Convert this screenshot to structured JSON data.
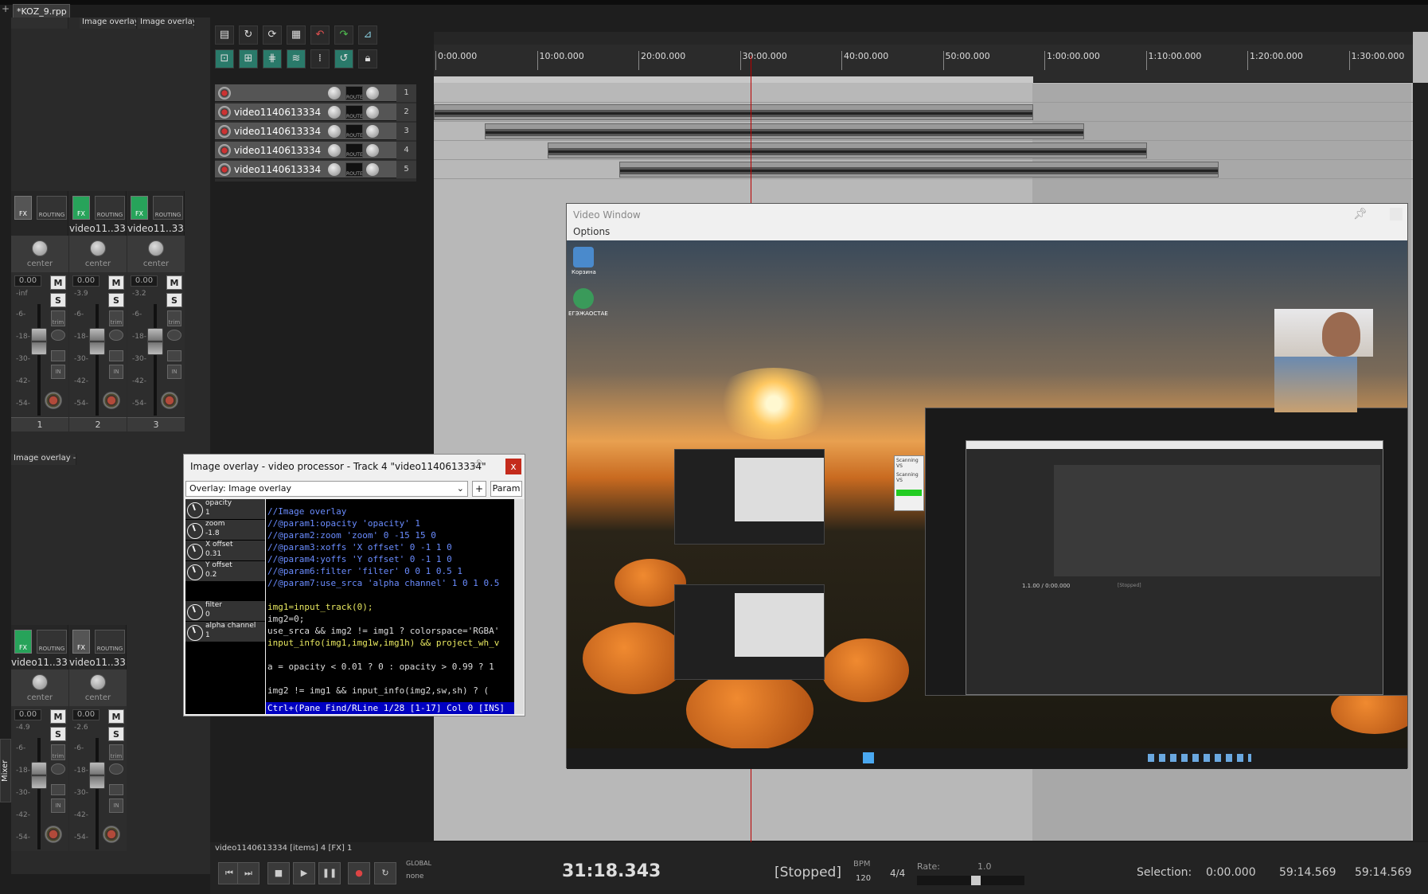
{
  "project": {
    "tab_title": "*KOZ_9.rpp"
  },
  "mixer": {
    "side_label": "Mixer",
    "top_headers": [
      "Image overlay - v",
      "Image overlay - v"
    ],
    "bottom_header": "Image overlay - v",
    "strips_top": [
      {
        "name": "",
        "number": "1",
        "db": "0.00",
        "peak": "-inf",
        "pan": "center",
        "fx_on": false,
        "fader_level": 0.75
      },
      {
        "name": "video11..3334",
        "number": "2",
        "db": "0.00",
        "peak": "-3.9",
        "pan": "center",
        "fx_on": true,
        "fader_level": 0.75
      },
      {
        "name": "video11..3334",
        "number": "3",
        "db": "0.00",
        "peak": "-3.2",
        "pan": "center",
        "fx_on": true,
        "fader_level": 0.75
      }
    ],
    "strips_bottom": [
      {
        "name": "video11..3334",
        "db": "0.00",
        "peak": "-4.9",
        "pan": "center",
        "fx_on": true,
        "fader_level": 0.75
      },
      {
        "name": "video11..3334",
        "db": "0.00",
        "peak": "-2.6",
        "pan": "center",
        "fx_on": false,
        "fader_level": 0.75
      }
    ],
    "scale": [
      "-6-",
      "-18-",
      "-30-",
      "-42-",
      "-54-"
    ],
    "labels": {
      "fx": "FX",
      "routing": "ROUTING",
      "m": "M",
      "s": "S",
      "trim": "trim",
      "in": "IN"
    }
  },
  "tracks": [
    {
      "name": "",
      "number": "1"
    },
    {
      "name": "video1140613334",
      "number": "2"
    },
    {
      "name": "video1140613334",
      "number": "3"
    },
    {
      "name": "video1140613334",
      "number": "4"
    },
    {
      "name": "video1140613334",
      "number": "5"
    }
  ],
  "track_labels": {
    "route": "ROUTE"
  },
  "ruler": {
    "ticks": [
      "0:00.000",
      "10:00.000",
      "20:00.000",
      "30:00.000",
      "40:00.000",
      "50:00.000",
      "1:00:00.000",
      "1:10:00.000",
      "1:20:00.000",
      "1:30:00.000"
    ]
  },
  "video_window": {
    "title": "Video Window",
    "menu": "Options"
  },
  "desktop": {
    "icons": [
      "Корзина",
      "ЕГЭЖАОСТАЕ"
    ],
    "scanning": [
      "Scanning VS",
      "Scanning VS"
    ],
    "inner_status": "1.1.00 / 0:00.000",
    "inner_stopped": "[Stopped]"
  },
  "overlay": {
    "title": "Image overlay - video processor - Track 4 \"video1140613334\"",
    "preset": "Overlay: Image overlay",
    "plus": "+",
    "param": "Param",
    "close": "x",
    "params": [
      {
        "label": "opacity",
        "value": "1"
      },
      {
        "label": "zoom",
        "value": "-1.8"
      },
      {
        "label": "X offset",
        "value": "0.31"
      },
      {
        "label": "Y offset",
        "value": "0.2"
      },
      {
        "label": "filter",
        "value": "0"
      },
      {
        "label": "alpha channel",
        "value": "1"
      }
    ],
    "code_lines": [
      {
        "text": "//Image overlay",
        "color": "#6a8cff"
      },
      {
        "text": "//@param1:opacity 'opacity' 1",
        "color": "#6a8cff"
      },
      {
        "text": "//@param2:zoom 'zoom' 0 -15 15 0",
        "color": "#6a8cff"
      },
      {
        "text": "//@param3:xoffs 'X offset' 0 -1 1 0",
        "color": "#6a8cff"
      },
      {
        "text": "//@param4:yoffs 'Y offset' 0 -1 1 0",
        "color": "#6a8cff"
      },
      {
        "text": "//@param6:filter 'filter' 0 0 1 0.5 1",
        "color": "#6a8cff"
      },
      {
        "text": "//@param7:use_srca 'alpha channel' 1 0 1 0.5",
        "color": "#6a8cff"
      },
      {
        "text": "",
        "color": "#ddd"
      },
      {
        "text": "img1=input_track(0);",
        "color": "#e8e860"
      },
      {
        "text": "img2=0;",
        "color": "#ddd"
      },
      {
        "text": "use_srca && img2 != img1 ? colorspace='RGBA'",
        "color": "#ddd"
      },
      {
        "text": "input_info(img1,img1w,img1h) && project_wh_v",
        "color": "#e8e860"
      },
      {
        "text": "",
        "color": "#ddd"
      },
      {
        "text": "a = opacity < 0.01 ? 0 : opacity > 0.99 ? 1",
        "color": "#ddd"
      },
      {
        "text": "",
        "color": "#ddd"
      },
      {
        "text": "img2 != img1 && input_info(img2,sw,sh) ? (",
        "color": "#ddd"
      }
    ],
    "status": "Ctrl+(Pane Find/RLine 1/28 [1-17] Col 0 [INS]"
  },
  "transport": {
    "items_line": "video1140613334 [items] 4 [FX] 1",
    "global_label": "GLOBAL",
    "global_value": "none",
    "time": "31:18.343",
    "state": "[Stopped]",
    "bpm_label": "BPM",
    "bpm": "120",
    "signature": "4/4",
    "rate_label": "Rate:",
    "rate": "1.0",
    "selection_label": "Selection:",
    "sel_start": "0:00.000",
    "sel_end": "59:14.569",
    "sel_length": "59:14.569"
  }
}
